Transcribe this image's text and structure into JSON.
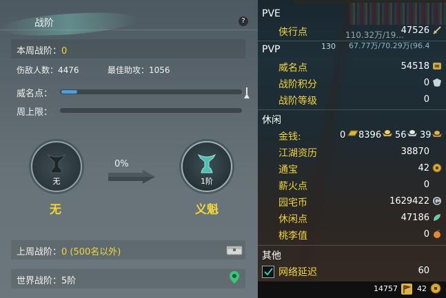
{
  "left_panel": {
    "title": "战阶",
    "help": "?",
    "this_week_rank_label": "本周战阶：",
    "this_week_rank_value": "0",
    "kills_label": "伤敌人数：",
    "kills_value": "4476",
    "best_assist_label": "最佳助攻：",
    "best_assist_value": "1056",
    "prestige_label": "威名点：",
    "prestige_progress": 0.09,
    "weekly_cap_label": "周上限：",
    "weekly_cap_progress": 0.0,
    "current_rank_level_text": "无",
    "current_rank_name": "无",
    "progress_percent": "0%",
    "next_rank_level_text": "1阶",
    "next_rank_name": "义魁",
    "last_week_label": "上周战阶：",
    "last_week_value": "0 (500名以外)",
    "world_rank_label": "世界战阶：",
    "world_rank_value": "5阶"
  },
  "right_panel": {
    "pve_header": "PVE",
    "pvp_header": "PVP",
    "leisure_header": "休闲",
    "other_header": "其他",
    "bg_numbers": [
      "110.32万/19...",
      "67.77万/70.29万(96.4",
      "130"
    ],
    "pve": [
      {
        "label": "侠行点",
        "value": "47526",
        "icon": "sword-icon"
      }
    ],
    "pvp": [
      {
        "label": "威名点",
        "value": "54518",
        "icon": "prestige-icon"
      },
      {
        "label": "战阶积分",
        "value": "0",
        "icon": "crest-icon"
      },
      {
        "label": "战阶等级",
        "value": "0",
        "icon": ""
      }
    ],
    "money": {
      "label": "金钱:",
      "gold": "0",
      "silver": "8396",
      "ingot_a": "56",
      "ingot_b": "39"
    },
    "leisure": [
      {
        "label": "江湖资历",
        "value": "38870",
        "icon": ""
      },
      {
        "label": "通宝",
        "value": "42",
        "icon": "coin-icon"
      },
      {
        "label": "薪火点",
        "value": "0",
        "icon": ""
      },
      {
        "label": "园宅币",
        "value": "1629422",
        "icon": "g-coin-icon"
      },
      {
        "label": "休闲点",
        "value": "47186",
        "icon": "leaf-icon"
      },
      {
        "label": "桃李值",
        "value": "0",
        "icon": "peach-icon"
      }
    ],
    "other": [
      {
        "label": "网络延迟",
        "value": "60",
        "checked": true
      }
    ],
    "bottom": {
      "left_value": "14757",
      "right_value": "42"
    }
  },
  "colors": {
    "accent_yellow": "#f2d53c",
    "bar_blue": "#4aa0e0"
  }
}
